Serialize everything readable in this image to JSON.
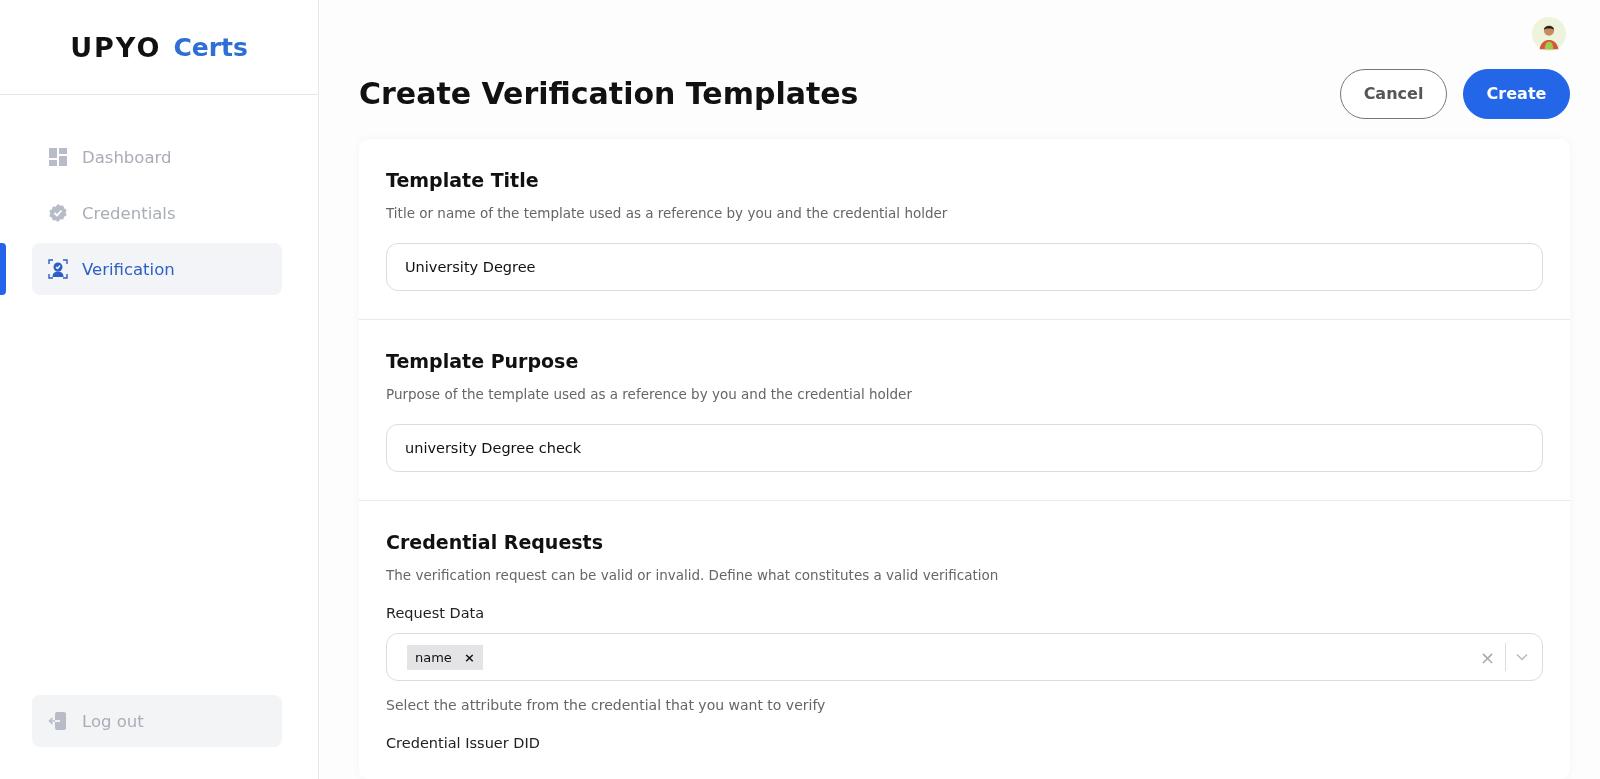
{
  "brand": {
    "name": "UPYO",
    "product": "Certs"
  },
  "sidebar": {
    "items": [
      {
        "label": "Dashboard",
        "kind": "grid",
        "selected": false
      },
      {
        "label": "Credentials",
        "kind": "badge",
        "selected": false
      },
      {
        "label": "Verification",
        "kind": "scan",
        "selected": true
      }
    ],
    "logout": "Log out"
  },
  "page": {
    "title": "Create Verification Templates",
    "buttons": [
      {
        "label": "Cancel",
        "kind": "secondary"
      },
      {
        "label": "Create",
        "kind": "primary"
      }
    ]
  },
  "sections": [
    {
      "title": "Template Title",
      "description": "Title or name of the template used as a reference by you and the credential holder",
      "value": "University Degree"
    },
    {
      "title": "Template Purpose",
      "description": "Purpose of the template used as a reference by you and the credential holder",
      "value": "university Degree check"
    },
    {
      "title": "Credential Requests",
      "description": "The verification request can be valid or invalid. Define what constitutes a valid verification",
      "request_data": {
        "label": "Request Data",
        "tags": [
          {
            "label": "name",
            "remove": "×"
          }
        ],
        "clear": "×",
        "hint": "Select the attribute from the credential that you want to verify"
      },
      "next_label": "Credential Issuer DID"
    }
  ]
}
